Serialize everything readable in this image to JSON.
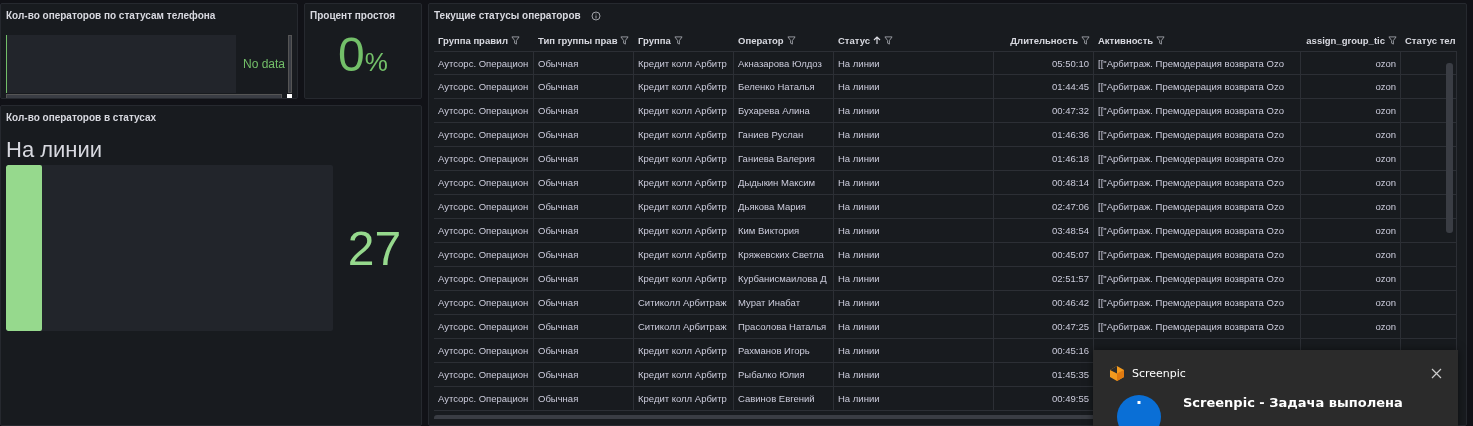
{
  "phone_status_panel": {
    "title": "Кол-во операторов по статусам телефона",
    "message": "No data"
  },
  "idle_panel": {
    "title": "Процент простоя",
    "value": "0",
    "unit": "%"
  },
  "status_count_panel": {
    "title": "Кол-во операторов в статусах",
    "bars": [
      {
        "label": "На линии",
        "value": "27",
        "level": 0.11
      }
    ]
  },
  "operators_table": {
    "title": "Текущие статусы операторов",
    "columns": [
      {
        "label": "Группа правил",
        "filter": true,
        "sorted_ascending": false,
        "numeric": false
      },
      {
        "label": "Тип группы прав",
        "filter": true,
        "sorted_ascending": false,
        "numeric": false
      },
      {
        "label": "Группа",
        "filter": true,
        "sorted_ascending": false,
        "numeric": false
      },
      {
        "label": "Оператор",
        "filter": true,
        "sorted_ascending": false,
        "numeric": false
      },
      {
        "label": "Статус",
        "filter": true,
        "sorted_ascending": true,
        "numeric": false
      },
      {
        "label": "Длительность",
        "filter": true,
        "sorted_ascending": false,
        "numeric": true
      },
      {
        "label": "Активность",
        "filter": true,
        "sorted_ascending": false,
        "numeric": false
      },
      {
        "label": "assign_group_tic",
        "filter": true,
        "sorted_ascending": false,
        "numeric": true
      },
      {
        "label": "Статус тел",
        "numeric": false
      }
    ],
    "rows": [
      [
        "Аутсорс. Операцион",
        "Обычная",
        "Кредит колл Арбитр",
        "Акназарова Юлдоз",
        "На линии",
        "05:50:10",
        "[[\"Арбитраж. Премодерация возврата Ozo",
        "ozon"
      ],
      [
        "Аутсорс. Операцион",
        "Обычная",
        "Кредит колл Арбитр",
        "Беленко Наталья",
        "На линии",
        "01:44:45",
        "[[\"Арбитраж. Премодерация возврата Ozo",
        "ozon"
      ],
      [
        "Аутсорс. Операцион",
        "Обычная",
        "Кредит колл Арбитр",
        "Бухарева Алина",
        "На линии",
        "00:47:32",
        "[[\"Арбитраж. Премодерация возврата Ozo",
        "ozon"
      ],
      [
        "Аутсорс. Операцион",
        "Обычная",
        "Кредит колл Арбитр",
        "Ганиев Руслан",
        "На линии",
        "01:46:36",
        "[[\"Арбитраж. Премодерация возврата Ozo",
        "ozon"
      ],
      [
        "Аутсорс. Операцион",
        "Обычная",
        "Кредит колл Арбитр",
        "Ганиева Валерия",
        "На линии",
        "01:46:18",
        "[[\"Арбитраж. Премодерация возврата Ozo",
        "ozon"
      ],
      [
        "Аутсорс. Операцион",
        "Обычная",
        "Кредит колл Арбитр",
        "Дыдыкин Максим",
        "На линии",
        "00:48:14",
        "[[\"Арбитраж. Премодерация возврата Ozo",
        "ozon"
      ],
      [
        "Аутсорс. Операцион",
        "Обычная",
        "Кредит колл Арбитр",
        "Дьякова Мария",
        "На линии",
        "02:47:06",
        "[[\"Арбитраж. Премодерация возврата Ozo",
        "ozon"
      ],
      [
        "Аутсорс. Операцион",
        "Обычная",
        "Кредит колл Арбитр",
        "Ким Виктория",
        "На линии",
        "03:48:54",
        "[[\"Арбитраж. Премодерация возврата Ozo",
        "ozon"
      ],
      [
        "Аутсорс. Операцион",
        "Обычная",
        "Кредит колл Арбитр",
        "Кряжевских Светла",
        "На линии",
        "00:45:07",
        "[[\"Арбитраж. Премодерация возврата Ozo",
        "ozon"
      ],
      [
        "Аутсорс. Операцион",
        "Обычная",
        "Кредит колл Арбитр",
        "Курбанисмаилова Д",
        "На линии",
        "02:51:57",
        "[[\"Арбитраж. Премодерация возврата Ozo",
        "ozon"
      ],
      [
        "Аутсорс. Операцион",
        "Обычная",
        "Ситиколл Арбитраж",
        "Мурат Инабат",
        "На линии",
        "00:46:42",
        "[[\"Арбитраж. Премодерация возврата Ozo",
        "ozon"
      ],
      [
        "Аутсорс. Операцион",
        "Обычная",
        "Ситиколл Арбитраж",
        "Прасолова Наталья",
        "На линии",
        "00:47:25",
        "[[\"Арбитраж. Премодерация возврата Ozo",
        "ozon"
      ],
      [
        "Аутсорс. Операцион",
        "Обычная",
        "Кредит колл Арбитр",
        "Рахманов Игорь",
        "На линии",
        "00:45:16"
      ],
      [
        "Аутсорс. Операцион",
        "Обычная",
        "Кредит колл Арбитр",
        "Рыбалко Юлия",
        "На линии",
        "01:45:35"
      ],
      [
        "Аутсорс. Операцион",
        "Обычная",
        "Кредит колл Арбитр",
        "Савинов Евгений",
        "На линии",
        "00:49:55"
      ]
    ]
  },
  "notification": {
    "app": "Screenpic",
    "title": "Screenpic - Задача выполена"
  }
}
